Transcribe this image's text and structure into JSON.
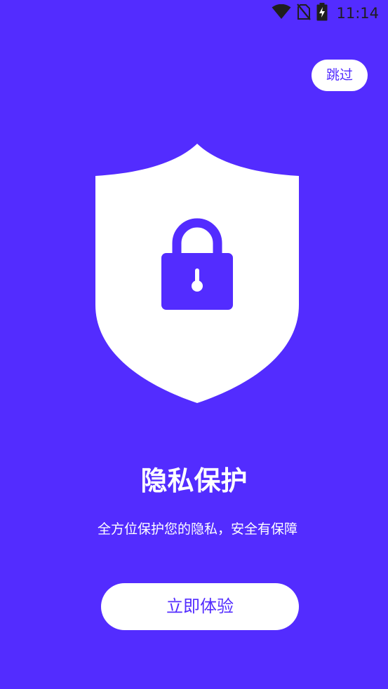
{
  "status_bar": {
    "time": "11:14",
    "icons": [
      "wifi-icon",
      "no-sim-icon",
      "battery-charging-icon"
    ]
  },
  "skip_button": {
    "label": "跳过"
  },
  "hero": {
    "icon": "shield-lock-icon",
    "title": "隐私保护",
    "subtitle": "全方位保护您的隐私，安全有保障"
  },
  "start_button": {
    "label": "立即体验"
  },
  "colors": {
    "background": "#532cff",
    "surface": "#ffffff",
    "status_icon": "#1e1e1e"
  }
}
